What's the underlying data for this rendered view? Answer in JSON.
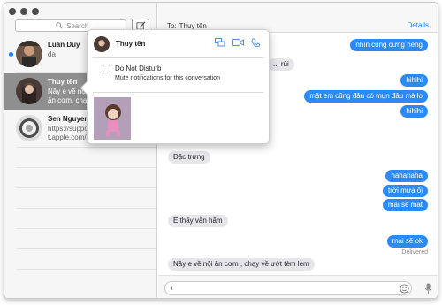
{
  "sidebar": {
    "search_placeholder": "Search",
    "conversations": [
      {
        "name": "Luân Duy",
        "preview": "da",
        "unread": true
      },
      {
        "name": "Thuy tên",
        "preview": "Nây e về nội ăn cơm, chạy về ướt tèm lem",
        "selected": true
      },
      {
        "name": "Sen Nguyen",
        "preview": "https://support.apple.com/en-us/HT204352"
      }
    ]
  },
  "chat": {
    "to_label": "To:",
    "recipient": "Thuy tên",
    "details_label": "Details",
    "messages": [
      {
        "dir": "out",
        "text": "nhìn cũng cưng heng"
      },
      {
        "dir": "in",
        "text": "... rùi"
      },
      {
        "dir": "out",
        "text": "hihihi"
      },
      {
        "dir": "out",
        "text": "mặt em cũng đâu có mụn đâu mà lo"
      },
      {
        "dir": "out",
        "text": "hihihi"
      },
      {
        "dir": "in",
        "text": "Đặc trưng"
      },
      {
        "dir": "out",
        "text": "hahahaha"
      },
      {
        "dir": "out",
        "text": "trời mưa ồi"
      },
      {
        "dir": "out",
        "text": "mai sẽ mát"
      },
      {
        "dir": "in",
        "text": "E thấy vẫn hẩm"
      },
      {
        "dir": "out",
        "text": "mai sẽ ok"
      },
      {
        "dir": "in",
        "text": "Nây e về nội ăn cơm , chạy về ướt tèm lem"
      }
    ],
    "delivered_label": "Delivered",
    "composer_value": "\\",
    "accent": "#2b8af7"
  },
  "popover": {
    "name": "Thuy tên",
    "dnd_label": "Do Not Disturb",
    "dnd_checked": false,
    "dnd_sub": "Mute notifications for this conversation",
    "icons": [
      "screen-share-icon",
      "video-call-icon",
      "phone-icon"
    ]
  }
}
